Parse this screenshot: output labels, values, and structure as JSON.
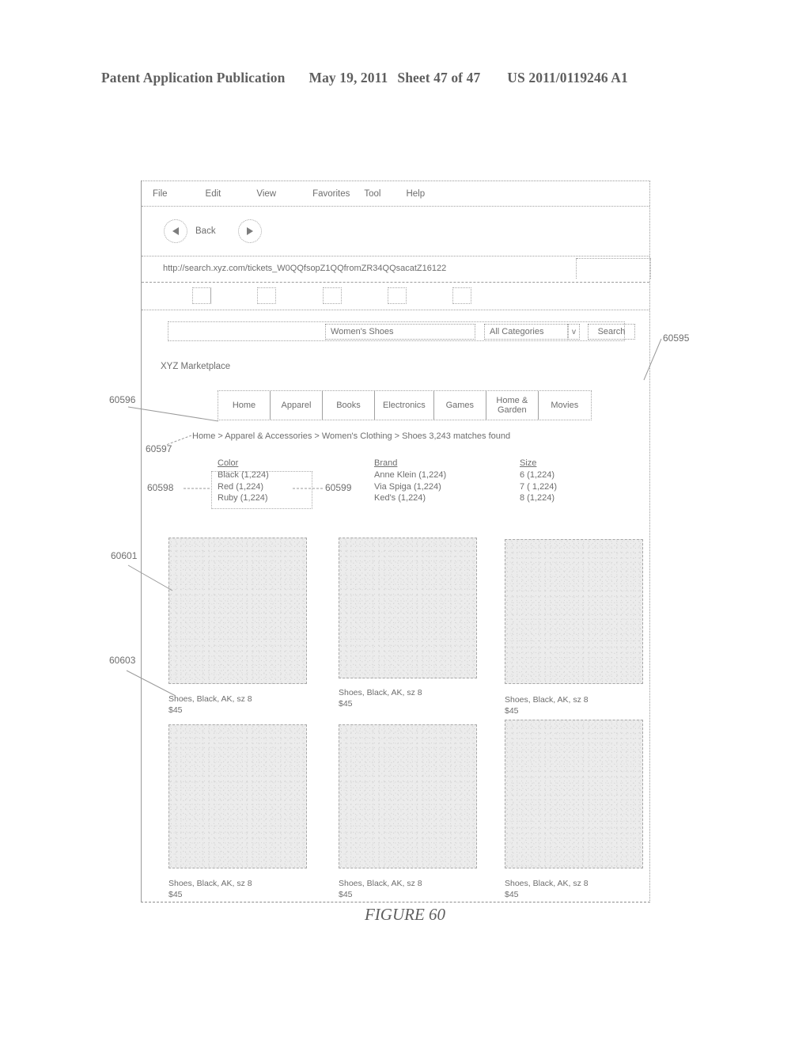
{
  "patent_header": {
    "title": "Patent Application Publication",
    "date": "May 19, 2011",
    "sheet": "Sheet 47 of 47",
    "publication_number": "US 2011/0119246 A1"
  },
  "figure_caption": "FIGURE 60",
  "browser": {
    "menu_items": [
      "File",
      "Edit",
      "View",
      "Favorites",
      "Tool",
      "Help"
    ],
    "back_label": "Back",
    "back_icon": "triangle-left-icon",
    "forward_icon": "triangle-right-icon",
    "address_value": "http://search.xyz.com/tickets_W0QQfsopZ1QQfromZR34QQsacatZ16122",
    "toolbar_buttons": [
      "",
      "",
      "",
      "",
      ""
    ]
  },
  "search": {
    "query_value": "Women's Shoes",
    "category_value": "All Categories",
    "caret_glyph": "v",
    "button_label": "Search"
  },
  "site": {
    "brand": "XYZ Marketplace",
    "tabs": [
      "Home",
      "Apparel",
      "Books",
      "Electronics",
      "Games",
      "Home &\nGarden",
      "Movies"
    ],
    "breadcrumb": "Home > Apparel & Accessories > Women's Clothing > Shoes 3,243 matches found"
  },
  "facets": [
    {
      "heading": "Color",
      "items": [
        "Black (1,224)",
        "Red (1,224)",
        "Ruby (1,224)"
      ]
    },
    {
      "heading": "Brand",
      "items": [
        "Anne Klein (1,224)",
        "Via Spiga (1,224)",
        "Ked's (1,224)"
      ]
    },
    {
      "heading": "Size",
      "items": [
        "6  (1,224)",
        "7 ( 1,224)",
        "8 (1,224)"
      ]
    }
  ],
  "products": [
    {
      "title": "Shoes, Black, AK, sz 8",
      "price": "$45"
    },
    {
      "title": "Shoes, Black, AK, sz 8",
      "price": "$45"
    },
    {
      "title": "Shoes, Black, AK, sz 8",
      "price": "$45"
    },
    {
      "title": "Shoes, Black, AK, sz 8",
      "price": "$45"
    },
    {
      "title": "Shoes, Black, AK, sz 8",
      "price": "$45"
    },
    {
      "title": "Shoes, Black, AK, sz 8",
      "price": "$45"
    }
  ],
  "reference_numerals": {
    "n60595": "60595",
    "n60596": "60596",
    "n60597": "60597",
    "n60598": "60598",
    "n60599": "60599",
    "n60601": "60601",
    "n60603": "60603"
  }
}
